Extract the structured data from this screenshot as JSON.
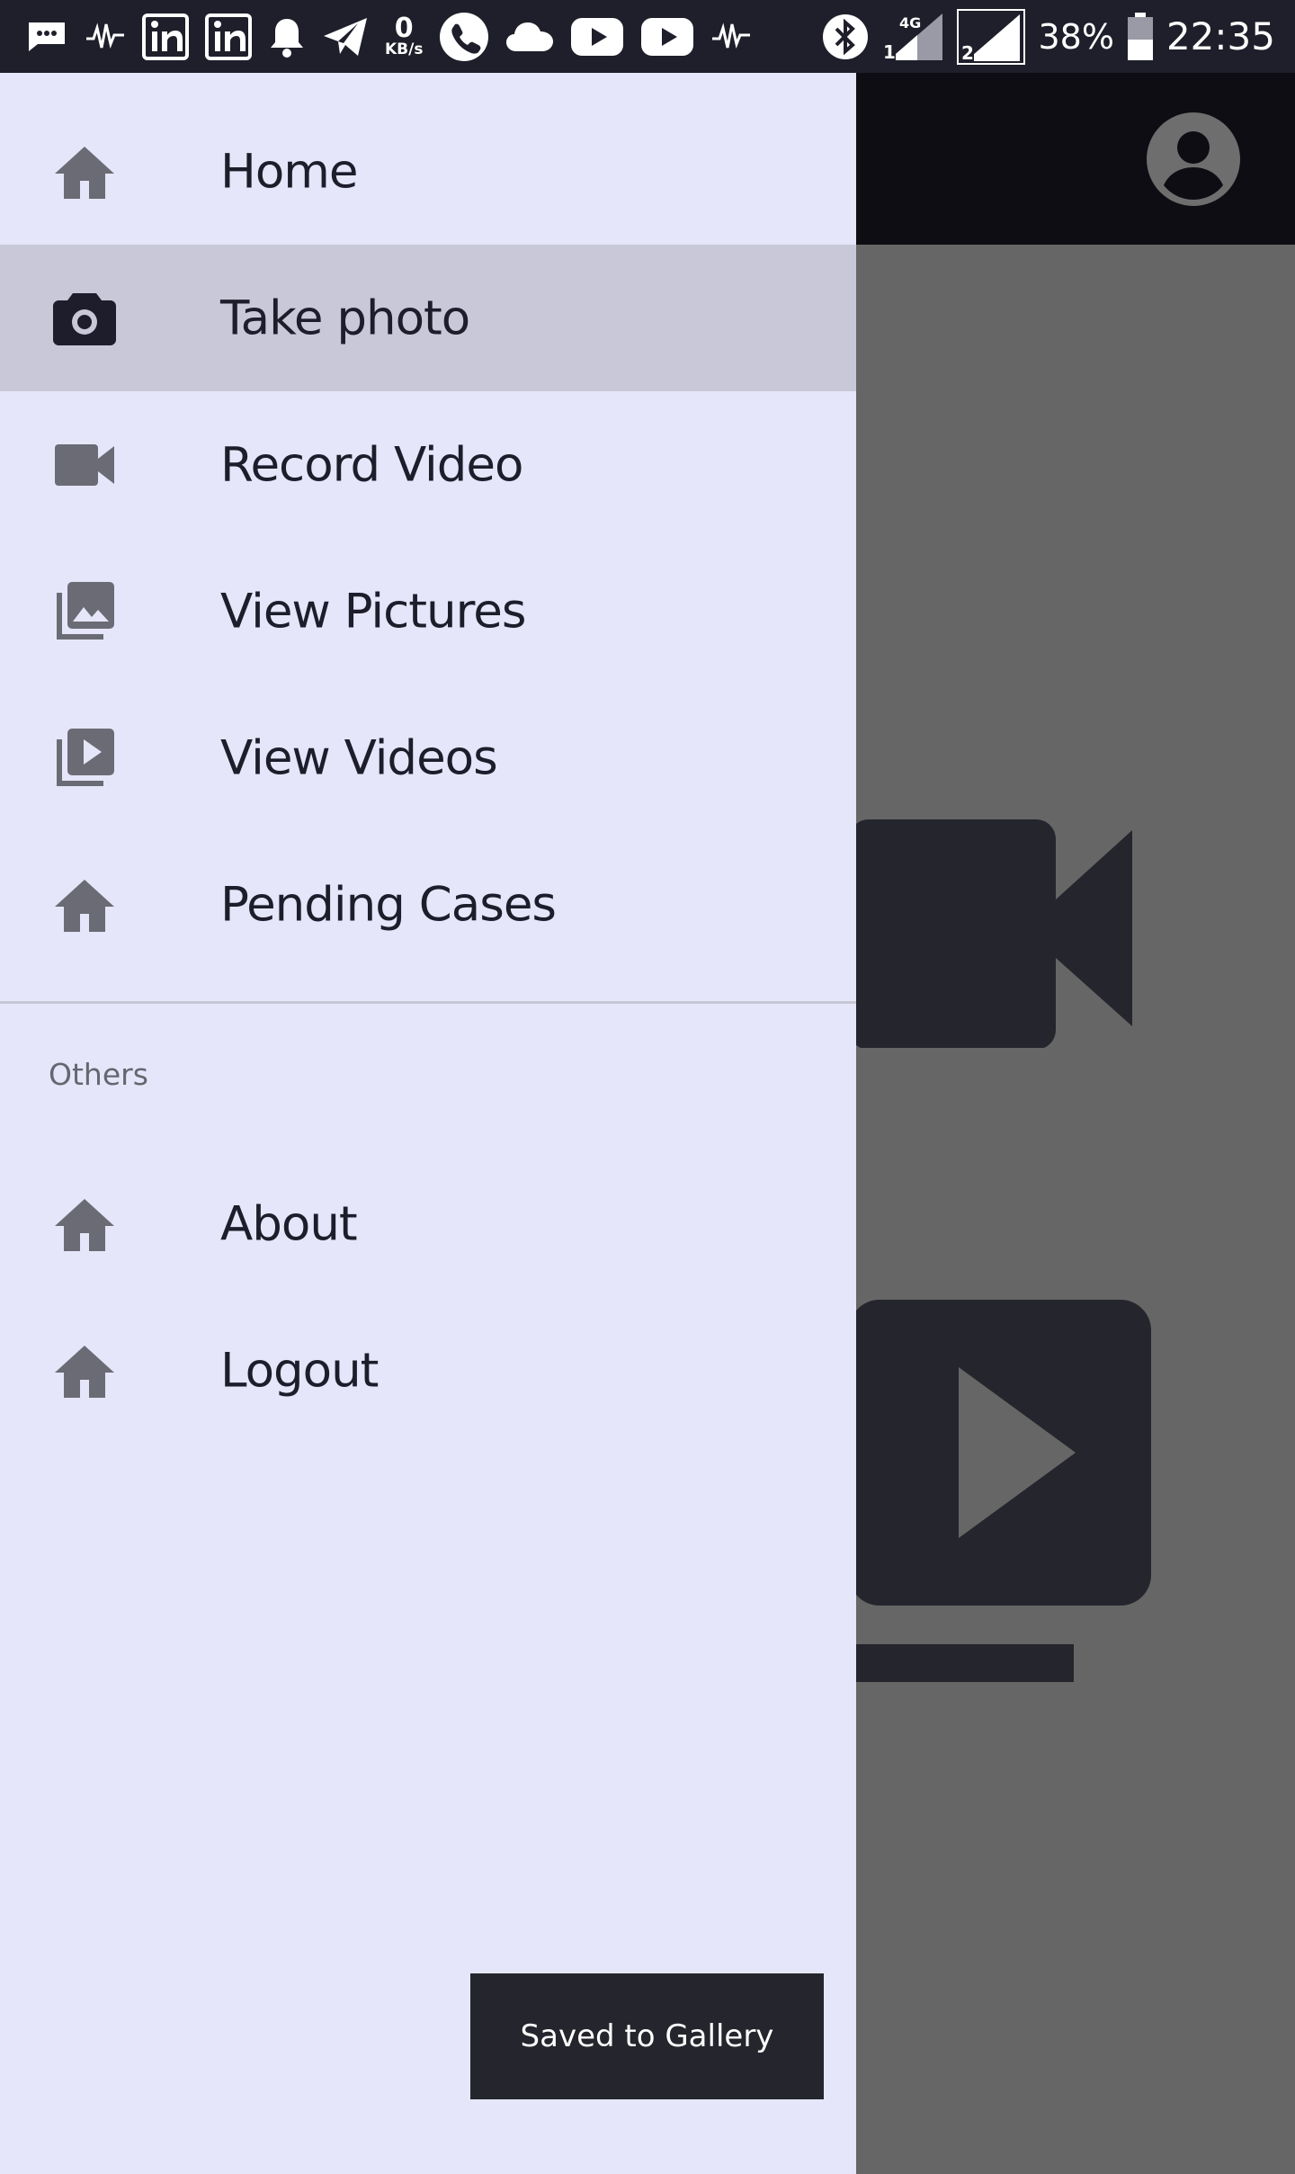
{
  "status_bar": {
    "left_icons": [
      "message-icon",
      "pulse-icon",
      "linkedin-icon",
      "linkedin-icon",
      "bell-icon",
      "telegram-icon"
    ],
    "net_speed_value": "0",
    "net_speed_unit": "KB/s",
    "left_icons_2": [
      "phone-icon",
      "cloud-icon",
      "youtube-icon",
      "youtube-icon",
      "pulse-icon"
    ],
    "sim1_label": "1",
    "sim1_network": "4G",
    "sim2_label": "2",
    "battery_percent": "38%",
    "time": "22:35"
  },
  "app_bar": {
    "account_icon": "account-circle-icon"
  },
  "drawer": {
    "items": [
      {
        "label": "Home",
        "icon": "home-icon",
        "active": false
      },
      {
        "label": "Take photo",
        "icon": "camera-icon",
        "active": true
      },
      {
        "label": "Record Video",
        "icon": "videocam-icon",
        "active": false
      },
      {
        "label": "View Pictures",
        "icon": "photo-library-icon",
        "active": false
      },
      {
        "label": "View Videos",
        "icon": "video-library-icon",
        "active": false
      },
      {
        "label": "Pending Cases",
        "icon": "home-icon",
        "active": false
      }
    ],
    "section_title": "Others",
    "other_items": [
      {
        "label": "About",
        "icon": "home-icon"
      },
      {
        "label": "Logout",
        "icon": "home-icon"
      }
    ]
  },
  "toast": {
    "message": "Saved to Gallery"
  },
  "colors": {
    "status_bar": "#1f1f2b",
    "app_bar": "#0d0d13",
    "scrim": "#666666",
    "drawer_bg": "#e6e6fa",
    "active_item_bg": "#c8c8d8",
    "text_primary": "#1d1d2b",
    "icon_grey": "#6b6b75",
    "toast_bg": "#25252d"
  }
}
